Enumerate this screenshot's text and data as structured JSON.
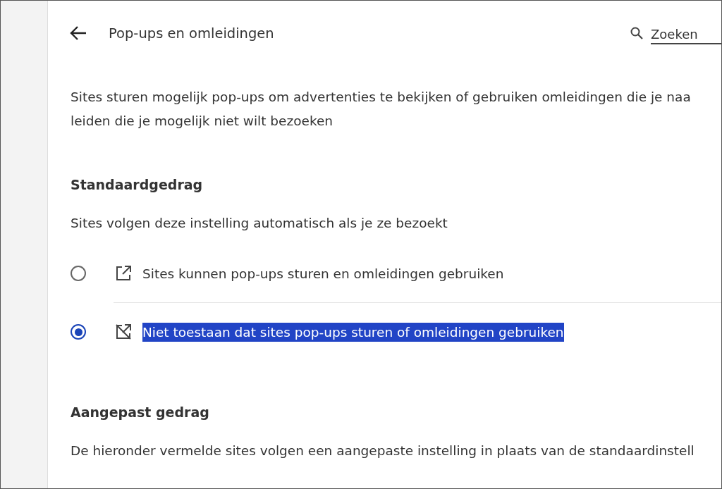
{
  "header": {
    "title": "Pop-ups en omleidingen",
    "search": {
      "placeholder": "Zoeken"
    }
  },
  "description": [
    "Sites sturen mogelijk pop-ups om advertenties te bekijken of gebruiken omleidingen die je naa",
    "leiden die je mogelijk niet wilt bezoeken"
  ],
  "default_behavior": {
    "heading": "Standaardgedrag",
    "subtitle": "Sites volgen deze instelling automatisch als je ze bezoekt",
    "options": [
      {
        "kind": "allow",
        "label": "Sites kunnen pop-ups sturen en omleidingen gebruiken",
        "selected": false,
        "highlighted": false
      },
      {
        "kind": "block",
        "label": "Niet toestaan dat sites pop-ups sturen of omleidingen gebruiken",
        "selected": true,
        "highlighted": true
      }
    ]
  },
  "custom_behavior": {
    "heading": "Aangepast gedrag",
    "subtitle": "De hieronder vermelde sites volgen een aangepaste instelling in plaats van de standaardinstell"
  }
}
